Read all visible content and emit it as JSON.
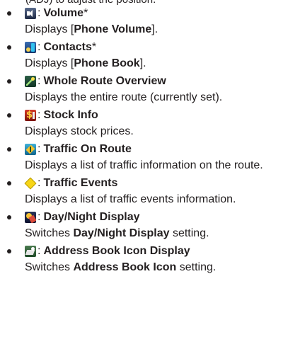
{
  "clipped_top_text": "(ADJ) to adjust the position.",
  "items": [
    {
      "icon": "volume-icon",
      "title": "Volume",
      "marker": "*",
      "desc_before": "Displays [",
      "desc_bold": "Phone Volume",
      "desc_after": "]."
    },
    {
      "icon": "contacts-icon",
      "title": "Contacts",
      "marker": "*",
      "desc_before": "Displays [",
      "desc_bold": "Phone Book",
      "desc_after": "]."
    },
    {
      "icon": "whole-route-overview-icon",
      "title": "Whole Route Overview",
      "marker": "",
      "desc_before": "Displays the entire route (currently set).",
      "desc_bold": "",
      "desc_after": ""
    },
    {
      "icon": "stock-info-icon",
      "title": "Stock Info",
      "marker": "",
      "desc_before": "Displays stock prices.",
      "desc_bold": "",
      "desc_after": ""
    },
    {
      "icon": "traffic-on-route-icon",
      "title": "Traffic On Route",
      "marker": "",
      "desc_before": "Displays a list of traffic information on the route.",
      "desc_bold": "",
      "desc_after": ""
    },
    {
      "icon": "traffic-events-icon",
      "title": "Traffic Events",
      "marker": "",
      "desc_before": "Displays a list of traffic events information.",
      "desc_bold": "",
      "desc_after": ""
    },
    {
      "icon": "day-night-display-icon",
      "title": "Day/Night Display",
      "marker": "",
      "desc_before": "Switches ",
      "desc_bold": "Day/Night Display",
      "desc_after": " setting."
    },
    {
      "icon": "address-book-icon-display-icon",
      "title": "Address Book Icon Display",
      "marker": "",
      "desc_before": "Switches ",
      "desc_bold": "Address Book Icon",
      "desc_after": " setting."
    }
  ],
  "separator": ":"
}
